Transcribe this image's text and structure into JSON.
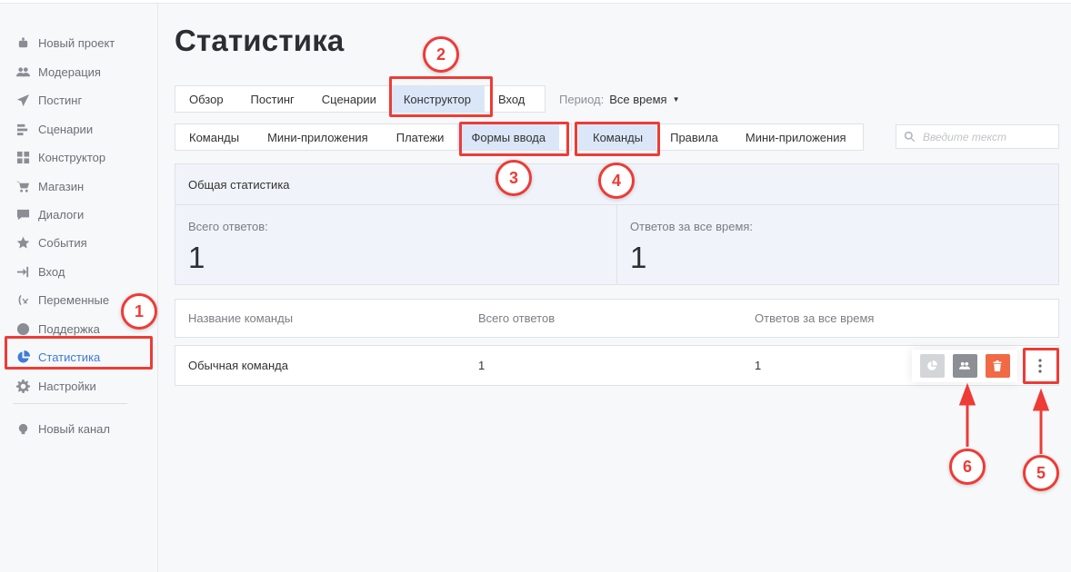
{
  "sidebar": {
    "items": [
      {
        "label": "Новый проект",
        "icon": "robot-icon"
      },
      {
        "label": "Модерация",
        "icon": "users-icon"
      },
      {
        "label": "Постинг",
        "icon": "paper-plane-icon"
      },
      {
        "label": "Сценарии",
        "icon": "scenario-icon"
      },
      {
        "label": "Конструктор",
        "icon": "grid-icon"
      },
      {
        "label": "Магазин",
        "icon": "cart-icon"
      },
      {
        "label": "Диалоги",
        "icon": "chat-icon"
      },
      {
        "label": "События",
        "icon": "star-icon"
      },
      {
        "label": "Вход",
        "icon": "login-icon"
      },
      {
        "label": "Переменные",
        "icon": "variable-icon"
      },
      {
        "label": "Поддержка",
        "icon": "help-icon"
      },
      {
        "label": "Статистика",
        "icon": "pie-chart-icon"
      },
      {
        "label": "Настройки",
        "icon": "gear-icon"
      }
    ],
    "active": "Статистика",
    "channel": {
      "label": "Новый канал",
      "icon": "channel-icon"
    }
  },
  "page": {
    "title": "Статистика"
  },
  "tabs_main": [
    "Обзор",
    "Постинг",
    "Сценарии",
    "Конструктор",
    "Вход"
  ],
  "tabs_main_selected": "Конструктор",
  "period": {
    "label": "Период:",
    "value": "Все время"
  },
  "tabs_sub": [
    "Команды",
    "Мини-приложения",
    "Платежи",
    "Формы ввода"
  ],
  "tabs_sub_selected": "Формы ввода",
  "tabs_sub2": [
    "Команды",
    "Правила",
    "Мини-приложения"
  ],
  "tabs_sub2_selected": "Команды",
  "search": {
    "placeholder": "Введите текст"
  },
  "stats": {
    "header": "Общая статистика",
    "total_label": "Всего ответов:",
    "total_value": "1",
    "alltime_label": "Ответов за все время:",
    "alltime_value": "1"
  },
  "table": {
    "columns": [
      "Название команды",
      "Всего ответов",
      "Ответов за все время"
    ],
    "rows": [
      {
        "name": "Обычная команда",
        "total": "1",
        "alltime": "1"
      }
    ]
  },
  "annotations": [
    "1",
    "2",
    "3",
    "4",
    "5",
    "6"
  ],
  "colors": {
    "accent": "#3d7bd9",
    "highlight": "#ee3b36",
    "tab_selected": "#dbe7f8",
    "delete": "#ef6a45"
  }
}
